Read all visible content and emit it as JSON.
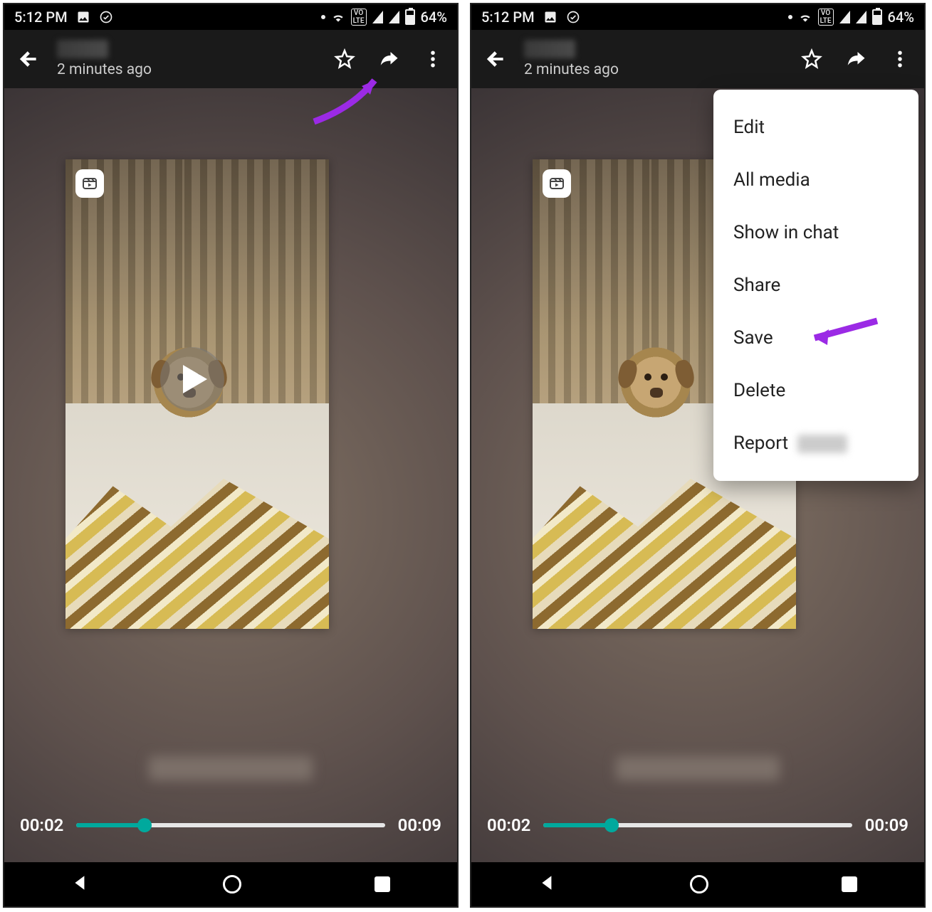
{
  "status": {
    "time": "5:12 PM",
    "battery_percent": "64%"
  },
  "header": {
    "timestamp": "2 minutes ago"
  },
  "playback": {
    "current": "00:02",
    "total": "00:09",
    "progress_percent": 22
  },
  "menu": {
    "items": [
      {
        "label": "Edit"
      },
      {
        "label": "All media"
      },
      {
        "label": "Show in chat"
      },
      {
        "label": "Share"
      },
      {
        "label": "Save"
      },
      {
        "label": "Delete"
      },
      {
        "label": "Report",
        "redacted_suffix": true
      }
    ]
  }
}
